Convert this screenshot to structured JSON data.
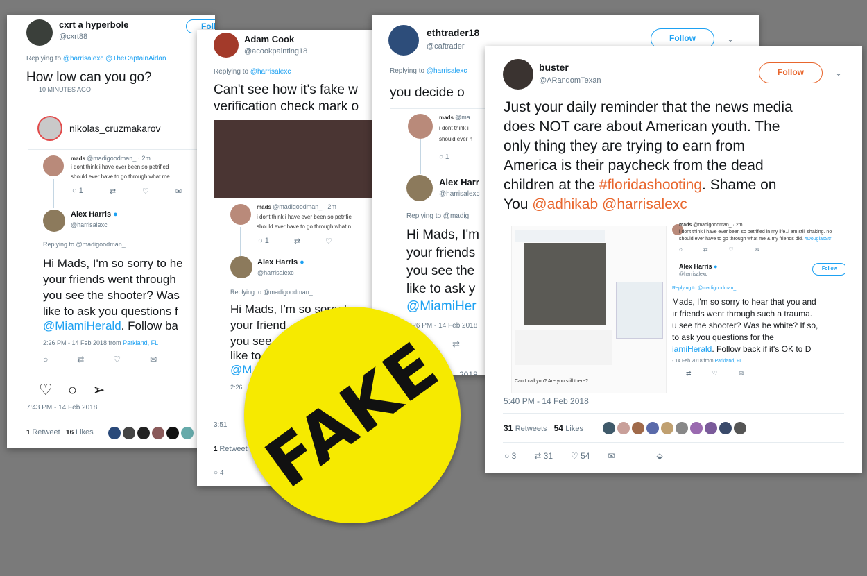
{
  "card1": {
    "name": "cxrt a hyperbole",
    "handle": "@cxrt88",
    "replying_prefix": "Replying to ",
    "replying_handles": "@harrisalexc @TheCaptainAidan",
    "text": "How low can you go?",
    "clipped_top": "10 MINUTES AGO",
    "ig_user": "nikolas_cruzmakarov",
    "mads_name": "mads",
    "mads_handle": "@madigoodman_ · 2m",
    "mads_text1": "i dont think i have ever been so petrified i",
    "mads_text2": "should ever have to go through what me",
    "mads_reply_count": "1",
    "alex_name": "Alex Harris",
    "alex_handle": "@harrisalexc",
    "alex_replying": "Replying to @madigoodman_",
    "alex_line1": "Hi Mads, I'm so sorry to he",
    "alex_line2": "your friends went through",
    "alex_line3": "you see the shooter? Was",
    "alex_line4": "like to ask you questions f",
    "alex_line5_mention": "@MiamiHerald",
    "alex_line5_rest": ". Follow ba",
    "alex_time": "2:26 PM - 14 Feb 2018 from ",
    "alex_place": "Parkland, FL",
    "time": "7:43 PM - 14 Feb 2018",
    "retweets_count": "1",
    "retweets_label": "Retweet",
    "likes_count": "16",
    "likes_label": "Likes",
    "follow_partial": "Follow"
  },
  "card2": {
    "name": "Adam Cook",
    "handle": "@acookpainting18",
    "replying_prefix": "Replying to ",
    "replying_handles": "@harrisalexc",
    "line1": "Can't see how it's fake w",
    "line2": "verification check mark o",
    "mads_name": "mads",
    "mads_handle": "@madigoodman_ · 2m",
    "mads_text1": "i dont think i have ever been so petrifie",
    "mads_text2": "should ever have to go through what n",
    "mads_reply_count": "1",
    "alex_name": "Alex Harris",
    "alex_handle": "@harrisalexc",
    "alex_replying": "Replying to @madigoodman_",
    "alex_line1": "Hi Mads, I'm so sorry to",
    "alex_line2": "your friend",
    "alex_line3": "you see",
    "alex_line4": "like to",
    "alex_line5": "@M",
    "alex_time": "2:26",
    "time": "3:51",
    "retweets_count": "1",
    "retweets_label": "Retweet",
    "reply_count": "4"
  },
  "card3": {
    "name": "ethtrader18",
    "handle": "@caftrader",
    "follow": "Follow",
    "replying_prefix": "Replying to ",
    "replying_handles": "@harrisalexc",
    "text": "you decide o",
    "mads_name": "mads",
    "mads_handle": "@ma",
    "mads_text1": "i dont think i",
    "mads_text2": "should ever h",
    "mads_reply_count": "1",
    "alex_name": "Alex Harr",
    "alex_handle": "@harrisalexc",
    "alex_replying": "Replying to @madig",
    "alex_line1": "Hi Mads, I'm",
    "alex_line2": "your friends",
    "alex_line3": "you see the",
    "alex_line4": "like to ask y",
    "alex_line5": "@MiamiHer",
    "alex_time": "2:26 PM - 14 Feb 2018",
    "time_partial": "2018"
  },
  "card4": {
    "name": "buster",
    "handle": "@ARandomTexan",
    "follow": "Follow",
    "text_line1": "Just your daily reminder that the news media",
    "text_line2": "does NOT care about American youth. The",
    "text_line3": "only thing they are trying to earn from",
    "text_line4": "America is their paycheck from the dead",
    "text_line5_pre": "children at the ",
    "hashtag": "#floridashooting",
    "text_line5_post": ". Shame on",
    "text_line6_pre": "You ",
    "mention1": "@adhikab",
    "mention2": "@harrisalexc",
    "embed": {
      "mini_caption1": "Can I call you? Are you still there?",
      "mads_name": "mads",
      "mads_handle": "@madigoodman_ · 2m",
      "mads_text1": "i dont think i have ever been so petrified in my life..i am still shaking. no",
      "mads_text2": "should ever have to go through what me & my friends did. ",
      "mads_hashtag": "#DouglasStr",
      "alex_name": "Alex Harris",
      "alex_handle": "@harrisalexc",
      "follow": "Follow",
      "alex_replying": "Replying to @madigoodman_",
      "alex_line1": "Mads, I'm so sorry to hear that you and",
      "alex_line2": "ır friends went through such a trauma.",
      "alex_line3": "u see the shooter? Was he white? If so,",
      "alex_line4": "to ask you questions for the",
      "alex_line5_mention": "iamiHerald",
      "alex_line5_rest": ". Follow back if it's OK to D",
      "alex_time": "- 14 Feb 2018 from ",
      "alex_place": "Parkland, FL"
    },
    "time": "5:40 PM - 14 Feb 2018",
    "retweets_count": "31",
    "retweets_label": "Retweets",
    "likes_count": "54",
    "likes_label": "Likes",
    "reply_count": "3",
    "rt_count": "31",
    "like_count": "54"
  },
  "stamp": {
    "label": "FAKE"
  },
  "colors": {
    "twitter_blue": "#1da1f2",
    "orange_accent": "#e8662d",
    "stamp_yellow": "#f6ea00"
  }
}
